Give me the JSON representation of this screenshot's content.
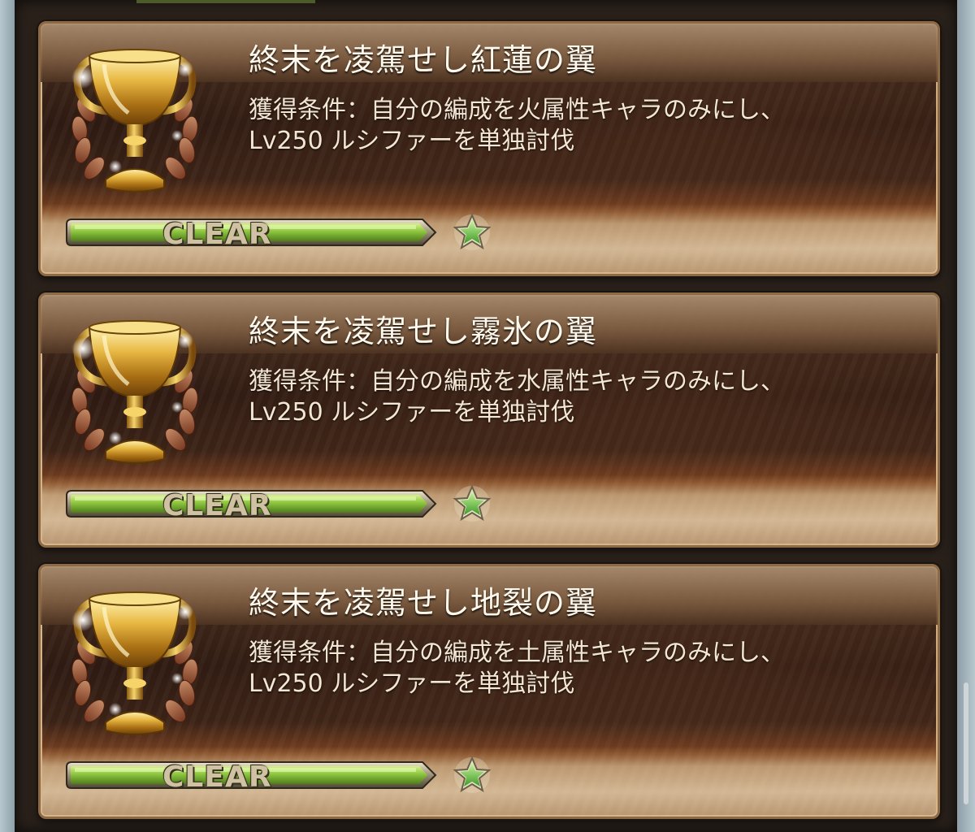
{
  "achievements": [
    {
      "title": "終末を凌駕せし紅蓮の翼",
      "condition_line1": "獲得条件：自分の編成を火属性キャラのみにし、",
      "condition_line2": "Lv250 ルシファーを単独討伐",
      "status_label": "CLEAR",
      "progress": 1.0,
      "stars": 1,
      "icon": "trophy-icon"
    },
    {
      "title": "終末を凌駕せし霧氷の翼",
      "condition_line1": "獲得条件：自分の編成を水属性キャラのみにし、",
      "condition_line2": "Lv250 ルシファーを単独討伐",
      "status_label": "CLEAR",
      "progress": 1.0,
      "stars": 1,
      "icon": "trophy-icon"
    },
    {
      "title": "終末を凌駕せし地裂の翼",
      "condition_line1": "獲得条件：自分の編成を土属性キャラのみにし、",
      "condition_line2": "Lv250 ルシファーを単独討伐",
      "status_label": "CLEAR",
      "progress": 1.0,
      "stars": 1,
      "icon": "trophy-icon"
    }
  ],
  "colors": {
    "progress_fill": "#8bc34a",
    "star_fill": "#7fd35a",
    "title_text": "#fff8ec",
    "frame": "#2a211b"
  }
}
